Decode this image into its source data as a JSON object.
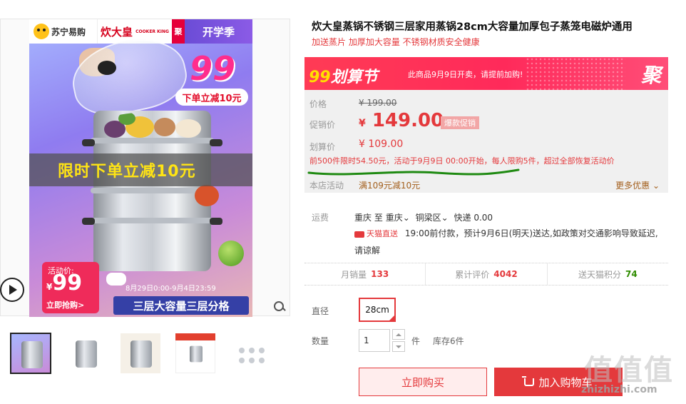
{
  "gallery": {
    "banner": {
      "store_name": "苏宁易购",
      "brand_cn": "炊大皇",
      "brand_en": "COOKER KING",
      "ju_tag": "聚",
      "season": "开学季"
    },
    "badge": {
      "number": "99",
      "text": "下单立减10元"
    },
    "promo_strip": "限时下单立减10元",
    "price_tag": {
      "label": "活动价:",
      "yen": "¥",
      "value": "99",
      "cta": "立即抢购>"
    },
    "date_range": "8月29日0:00-9月4日23:59",
    "bottom_strip": "三层大容量三层分格",
    "thumbnails": [
      "thumb-1",
      "thumb-2",
      "thumb-3",
      "thumb-4",
      "thumb-5"
    ]
  },
  "product": {
    "title": "炊大皇蒸锅不锈钢三层家用蒸锅28cm大容量加厚包子蒸笼电磁炉通用",
    "subtitle": "加送蒸片 加厚加大容量 不锈钢材质安全健康"
  },
  "event": {
    "logo_num": "99",
    "logo_text": "划算节",
    "message": "此商品9月9日开卖，请提前加购!",
    "ju": "聚"
  },
  "price": {
    "orig_label": "价格",
    "orig_value": "¥ 199.00",
    "promo_label": "促销价",
    "promo_yen": "¥",
    "promo_value": "149.00",
    "promo_tag": "爆款促销",
    "deal_label": "划算价",
    "deal_value": "¥ 109.00",
    "deal_note": "前500件限时54.50元，活动于9月9日 00:00开始，每人限购5件，超过全部恢复活动价",
    "store_label": "本店活动",
    "store_value": "满109元减10元",
    "more": "更多优惠"
  },
  "shipping": {
    "label": "运费",
    "from": "重庆",
    "to_word": "至",
    "city": "重庆",
    "district": "铜梁区",
    "express": "快递 0.00",
    "tmall": "天猫直送",
    "line2": "19:00前付款，预计9月6日(明天)送达,如政策对交通影响导致延迟,",
    "line3": "请谅解"
  },
  "stats": [
    {
      "label": "月销量",
      "value": "133"
    },
    {
      "label": "累计评价",
      "value": "4042"
    },
    {
      "label": "送天猫积分",
      "value": "74"
    }
  ],
  "spec": {
    "label": "直径",
    "option": "28cm"
  },
  "quantity": {
    "label": "数量",
    "value": "1",
    "unit": "件",
    "stock": "库存6件"
  },
  "actions": {
    "buy_now": "立即购买",
    "add_cart": "加入购物车"
  },
  "watermark": {
    "glyphs": "值值值",
    "text": "zhizhizhi.com"
  },
  "colors": {
    "accent": "#e4393c",
    "event_bar": "#ff2a5a",
    "price_box": "#f0f0f0"
  }
}
